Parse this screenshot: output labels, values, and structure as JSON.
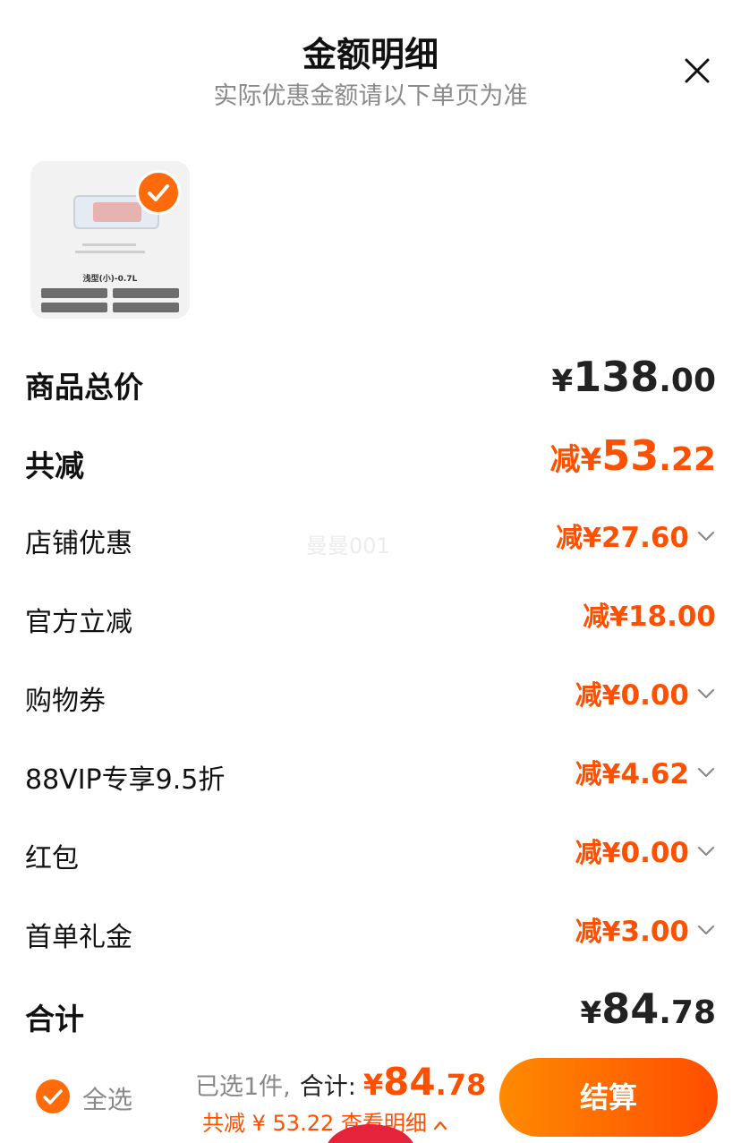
{
  "header": {
    "title": "金额明细",
    "subtitle": "实际优惠金额请以下单页为准",
    "close_icon": "close-icon"
  },
  "product": {
    "image_caption": "浅型(小)-0.7L",
    "selected": true
  },
  "rows": [
    {
      "label": "商品总价",
      "prefix": "",
      "currency": "¥",
      "int": "138",
      "dec": ".00",
      "emphasis": "total",
      "expandable": false
    },
    {
      "label": "共减",
      "prefix": "减",
      "currency": "¥",
      "int": "53",
      "dec": ".22",
      "emphasis": "discount-total",
      "expandable": false
    },
    {
      "label": "店铺优惠",
      "prefix": "减",
      "currency": "¥",
      "int": "27",
      "dec": ".60",
      "emphasis": "discount",
      "expandable": true
    },
    {
      "label": "官方立减",
      "prefix": "减",
      "currency": "¥",
      "int": "18",
      "dec": ".00",
      "emphasis": "discount",
      "expandable": false
    },
    {
      "label": "购物券",
      "prefix": "减",
      "currency": "¥",
      "int": "0",
      "dec": ".00",
      "emphasis": "discount",
      "expandable": true
    },
    {
      "label": "88VIP专享9.5折",
      "prefix": "减",
      "currency": "¥",
      "int": "4",
      "dec": ".62",
      "emphasis": "discount",
      "expandable": true
    },
    {
      "label": "红包",
      "prefix": "减",
      "currency": "¥",
      "int": "0",
      "dec": ".00",
      "emphasis": "discount",
      "expandable": true
    },
    {
      "label": "首单礼金",
      "prefix": "减",
      "currency": "¥",
      "int": "3",
      "dec": ".00",
      "emphasis": "discount",
      "expandable": true
    },
    {
      "label": "合计",
      "prefix": "",
      "currency": "¥",
      "int": "84",
      "dec": ".78",
      "emphasis": "total",
      "expandable": false
    }
  ],
  "watermark": "曼曼001",
  "footer": {
    "select_all": "全选",
    "selected_count": "已选1件,",
    "total_label": "合计:",
    "total_currency": "¥",
    "total_int": "84",
    "total_dec": ".78",
    "discount_detail": "共减 ¥ 53.22  查看明细",
    "checkout": "结算"
  },
  "colors": {
    "accent": "#ff5000",
    "button_gradient_start": "#ff8a00",
    "button_gradient_end": "#ff4d00"
  }
}
